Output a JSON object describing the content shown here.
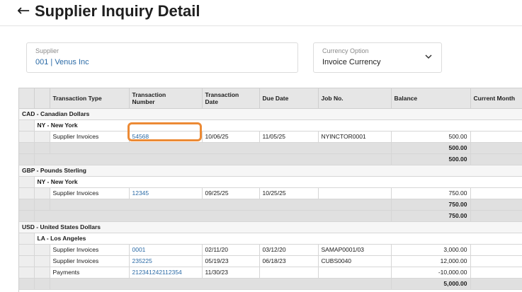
{
  "header": {
    "back_icon": "arrow-left-icon",
    "title": "Supplier Inquiry Detail"
  },
  "supplier": {
    "label": "Supplier",
    "value": "001 | Venus Inc"
  },
  "currency": {
    "label": "Currency Option",
    "value": "Invoice Currency"
  },
  "columns": {
    "transaction_type": "Transaction Type",
    "transaction_number_1": "Transaction",
    "transaction_number_2": "Number",
    "transaction_date_1": "Transaction",
    "transaction_date_2": "Date",
    "due_date": "Due Date",
    "job_no": "Job No.",
    "balance": "Balance",
    "current_month": "Current Month"
  },
  "groups": [
    {
      "currency": "CAD - Canadian Dollars",
      "location": "NY - New York",
      "rows": [
        {
          "type": "Supplier Invoices",
          "number": "54568",
          "date": "10/06/25",
          "due": "11/05/25",
          "job": "NYINCTOR0001",
          "balance": "500.00"
        }
      ],
      "location_total": "500.00",
      "currency_total": "500.00"
    },
    {
      "currency": "GBP - Pounds Sterling",
      "location": "NY - New York",
      "rows": [
        {
          "type": "Supplier Invoices",
          "number": "12345",
          "date": "09/25/25",
          "due": "10/25/25",
          "job": "",
          "balance": "750.00"
        }
      ],
      "location_total": "750.00",
      "currency_total": "750.00"
    },
    {
      "currency": "USD - United States Dollars",
      "location": "LA - Los Angeles",
      "rows": [
        {
          "type": "Supplier Invoices",
          "number": "0001",
          "date": "02/11/20",
          "due": "03/12/20",
          "job": "SAMAP0001/03",
          "balance": "3,000.00"
        },
        {
          "type": "Supplier Invoices",
          "number": "235225",
          "date": "05/19/23",
          "due": "06/18/23",
          "job": "CUBS0040",
          "balance": "12,000.00"
        },
        {
          "type": "Payments",
          "number": "212341242112354",
          "date": "11/30/23",
          "due": "",
          "job": "",
          "balance": "-10,000.00"
        }
      ],
      "location_total": "5,000.00"
    }
  ],
  "colors": {
    "link": "#2a6aa6",
    "highlight": "#ec8a35"
  }
}
